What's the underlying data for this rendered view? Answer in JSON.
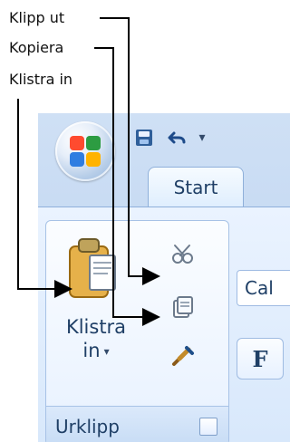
{
  "labels": {
    "cut": "Klipp ut",
    "copy": "Kopiera",
    "paste": "Klistra in"
  },
  "ribbon": {
    "tab": "Start",
    "group_name": "Urklipp",
    "paste_label": "Klistra",
    "paste_sub": "in",
    "font_name": "Cal",
    "bold_label": "F"
  },
  "colors": {
    "ui_text": "#1f3f66",
    "ribbon_border": "#8fb0da",
    "annotation": "#000000"
  },
  "icons": {
    "office_button": "office-logo",
    "save": "save-icon",
    "undo": "undo-icon",
    "cut": "scissors-icon",
    "copy": "copy-icon",
    "paste": "clipboard-icon",
    "format_painter": "format-painter-icon",
    "dialog_launcher": "dialog-launcher-icon"
  }
}
